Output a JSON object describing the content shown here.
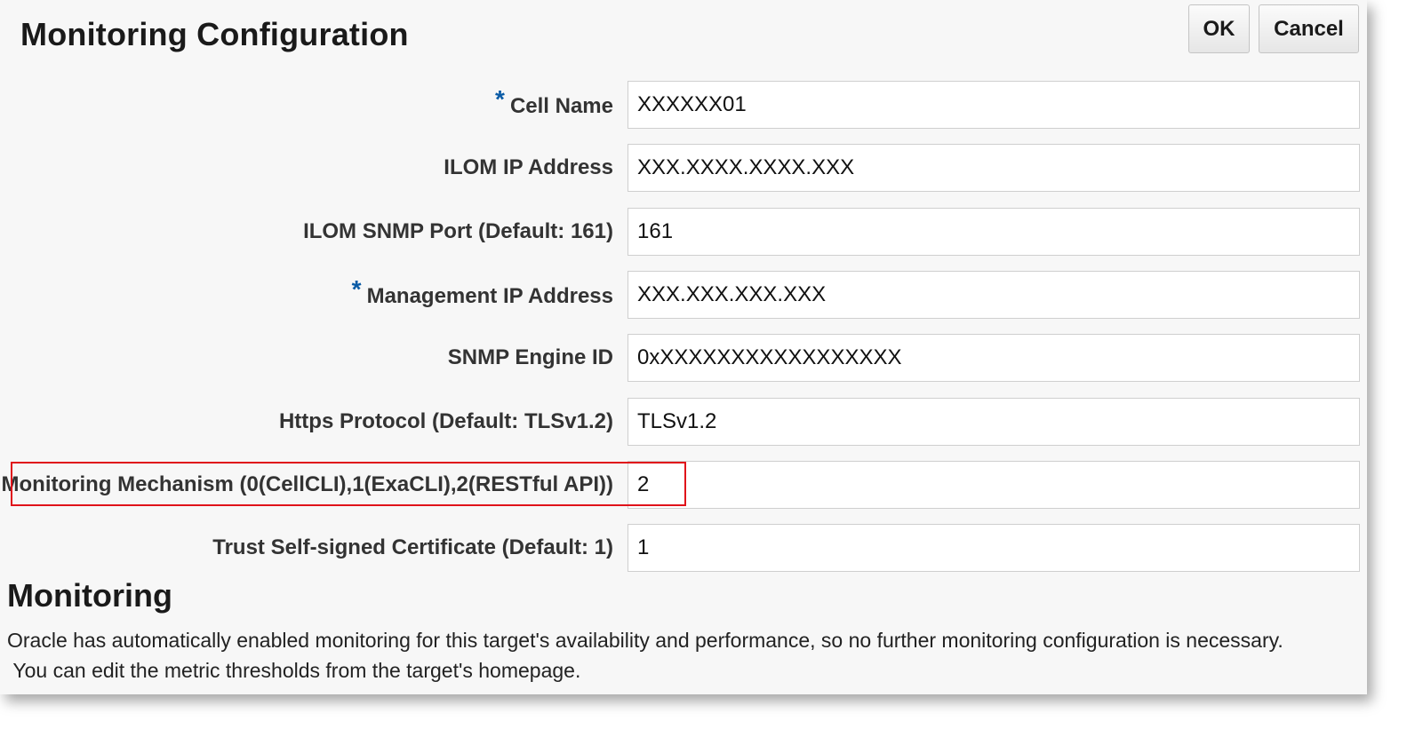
{
  "header": {
    "title": "Monitoring Configuration",
    "ok_label": "OK",
    "cancel_label": "Cancel"
  },
  "form": {
    "required_marker": "*",
    "fields": [
      {
        "label": "Cell Name",
        "value": "XXXXXX01",
        "required": true
      },
      {
        "label": "ILOM IP Address",
        "value": "XXX.XXXX.XXXX.XXX",
        "required": false
      },
      {
        "label": "ILOM SNMP Port (Default: 161)",
        "value": "161",
        "required": false
      },
      {
        "label": "Management IP Address",
        "value": "XXX.XXX.XXX.XXX",
        "required": true
      },
      {
        "label": "SNMP Engine ID",
        "value": "0xXXXXXXXXXXXXXXXXX",
        "required": false
      },
      {
        "label": "Https Protocol (Default: TLSv1.2)",
        "value": "TLSv1.2",
        "required": false
      },
      {
        "label": "Monitoring Mechanism (0(CellCLI),1(ExaCLI),2(RESTful API))",
        "value": "2",
        "required": false,
        "highlighted": true
      },
      {
        "label": "Trust Self-signed Certificate (Default: 1)",
        "value": "1",
        "required": false
      }
    ]
  },
  "monitoring": {
    "title": "Monitoring",
    "line1": "Oracle has automatically enabled monitoring for this target's availability and performance, so no further monitoring configuration is necessary.",
    "line2": "You can edit the metric thresholds from the target's homepage."
  },
  "colors": {
    "required_marker": "#0a5ba6",
    "highlight_border": "#e0121a",
    "panel_background": "#f7f7f7"
  }
}
